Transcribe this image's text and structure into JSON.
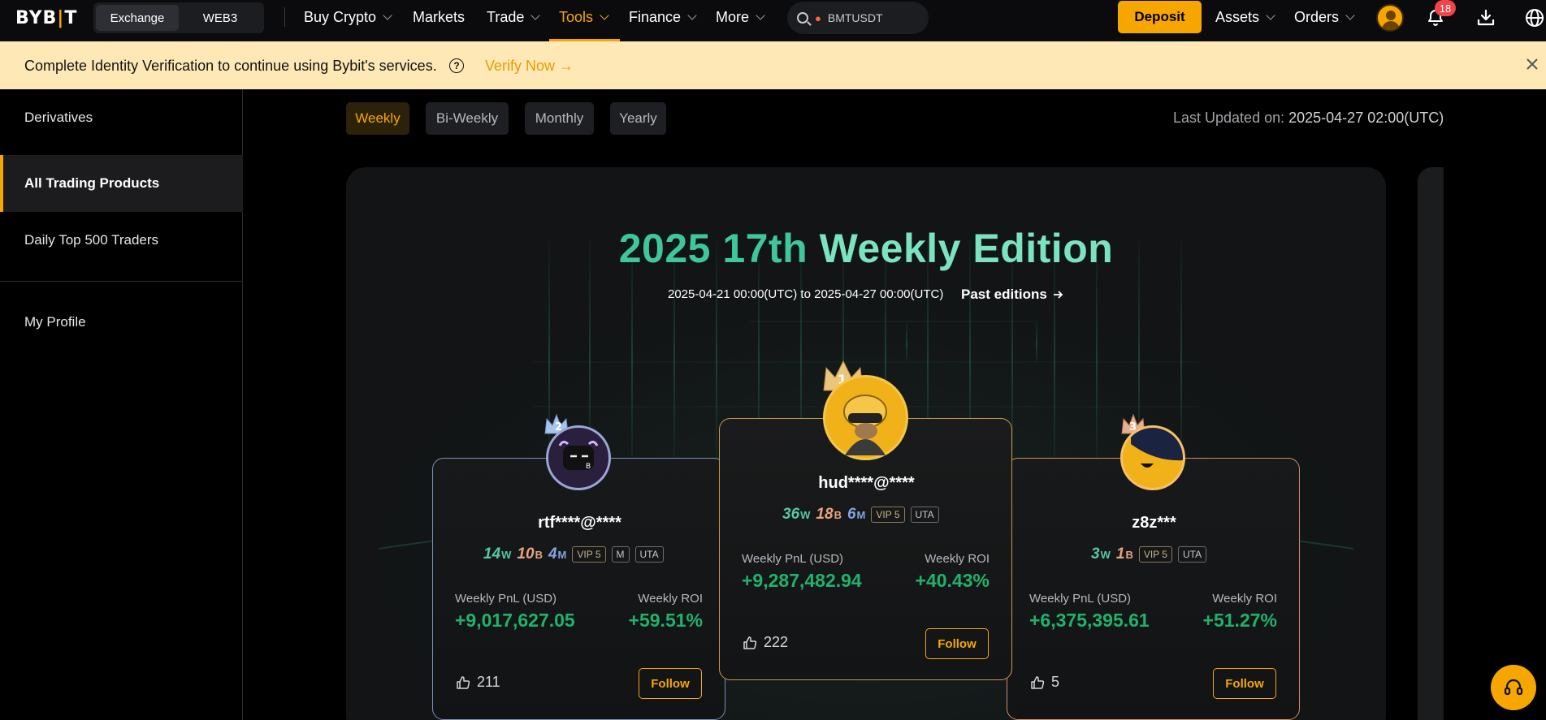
{
  "nav": {
    "logo": "BYB|T",
    "segments": [
      "Exchange",
      "WEB3"
    ],
    "items": [
      "Buy Crypto",
      "Markets",
      "Trade",
      "Tools",
      "Finance",
      "More"
    ],
    "search_text": "BMTUSDT",
    "deposit": "Deposit",
    "assets": "Assets",
    "orders": "Orders",
    "notification_count": "18",
    "accent": "#f7a600"
  },
  "banner": {
    "text": "Complete Identity Verification to continue using Bybit's services.",
    "verify": "Verify Now"
  },
  "sidebar": {
    "items": [
      "Derivatives",
      "All Trading Products",
      "Daily Top 500 Traders",
      "My Profile"
    ],
    "active": "All Trading Products"
  },
  "periods": [
    "Weekly",
    "Bi-Weekly",
    "Monthly",
    "Yearly"
  ],
  "active_period": "Weekly",
  "updated": {
    "label": "Last Updated on:",
    "value": "2025-04-27 02:00(UTC)"
  },
  "edition": {
    "title_a": "2025 17th",
    "title_b": "Weekly Edition",
    "range": "2025-04-21 00:00(UTC) to 2025-04-27 00:00(UTC)",
    "past": "Past editions"
  },
  "traders": {
    "first": {
      "rank": "1",
      "name": "hud****@****",
      "w": "36",
      "b": "18",
      "m": "6",
      "vip": "VIP 5",
      "uta": "UTA",
      "pnl_label": "Weekly PnL (USD)",
      "pnl": "+9,287,482.94",
      "roi_label": "Weekly ROI",
      "roi": "+40.43%",
      "likes": "222",
      "follow": "Follow"
    },
    "second": {
      "rank": "2",
      "name": "rtf****@****",
      "w": "14",
      "b": "10",
      "m": "4",
      "vip": "VIP 5",
      "mtag": "M",
      "uta": "UTA",
      "pnl_label": "Weekly PnL (USD)",
      "pnl": "+9,017,627.05",
      "roi_label": "Weekly ROI",
      "roi": "+59.51%",
      "likes": "211",
      "follow": "Follow"
    },
    "third": {
      "rank": "3",
      "name": "z8z***",
      "w": "3",
      "b": "1",
      "vip": "VIP 5",
      "uta": "UTA",
      "pnl_label": "Weekly PnL (USD)",
      "pnl": "+6,375,395.61",
      "roi_label": "Weekly ROI",
      "roi": "+51.27%",
      "likes": "5",
      "follow": "Follow"
    }
  },
  "icons": [
    "search-icon",
    "bell-icon",
    "download-icon",
    "globe-icon",
    "close-icon",
    "question-icon",
    "thumbs-up-icon",
    "headset-icon",
    "arrow-right-icon"
  ]
}
